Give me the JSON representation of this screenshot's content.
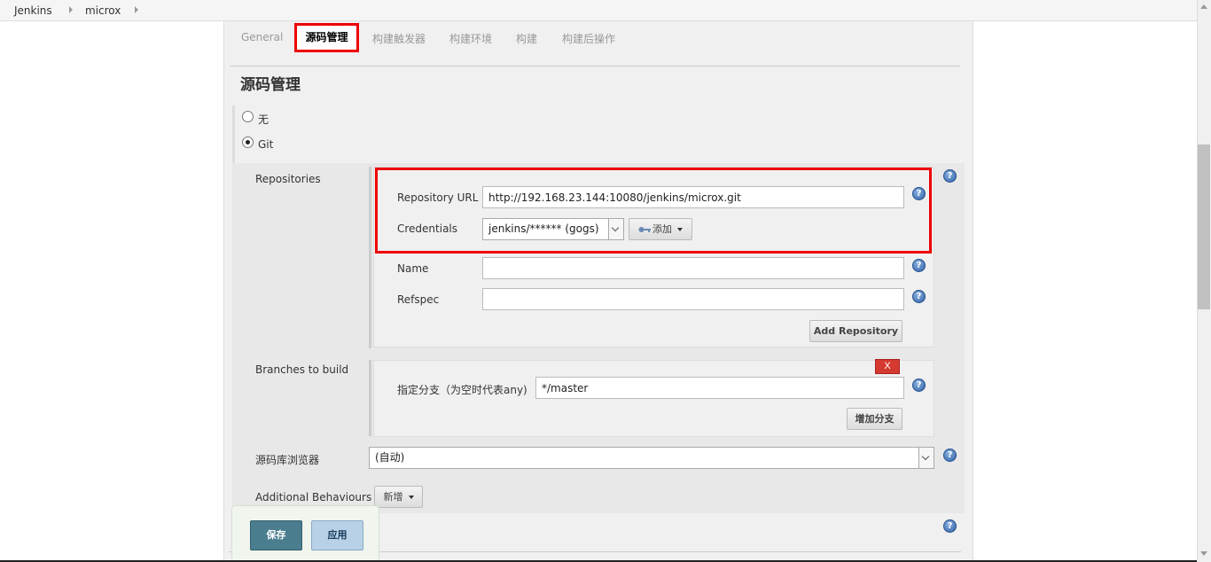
{
  "breadcrumb": {
    "items": [
      "Jenkins",
      "microx"
    ]
  },
  "tabs": [
    {
      "label": "General",
      "active": false
    },
    {
      "label": "源码管理",
      "active": true
    },
    {
      "label": "构建触发器",
      "active": false
    },
    {
      "label": "构建环境",
      "active": false
    },
    {
      "label": "构建",
      "active": false
    },
    {
      "label": "构建后操作",
      "active": false
    }
  ],
  "scm": {
    "title": "源码管理",
    "options": [
      {
        "label": "无",
        "selected": false
      },
      {
        "label": "Git",
        "selected": true
      }
    ],
    "repositories": {
      "label": "Repositories",
      "url_label": "Repository URL",
      "url_value": "http://192.168.23.144:10080/jenkins/microx.git",
      "credentials_label": "Credentials",
      "credentials_value": "jenkins/****** (gogs)",
      "add_label": "添加",
      "name_label": "Name",
      "name_value": "",
      "refspec_label": "Refspec",
      "refspec_value": "",
      "add_repository_label": "Add Repository"
    },
    "branches": {
      "label": "Branches to build",
      "delete_label": "X",
      "specifier_label": "指定分支（为空时代表any)",
      "specifier_value": "*/master",
      "add_branch_label": "增加分支"
    },
    "browser": {
      "label": "源码库浏览器",
      "value": "(自动)"
    },
    "additional": {
      "label": "Additional Behaviours",
      "add_label": "新增"
    }
  },
  "actions": {
    "save_label": "保存",
    "apply_label": "应用"
  },
  "colors": {
    "highlight": "#e00000",
    "help": "#2d5fa6",
    "save": "#4a7d8e",
    "apply": "#b8d1e6",
    "delete": "#d43a2f"
  },
  "icons": [
    "help-icon",
    "key-icon",
    "chevron-down-icon",
    "chevron-right-icon"
  ]
}
